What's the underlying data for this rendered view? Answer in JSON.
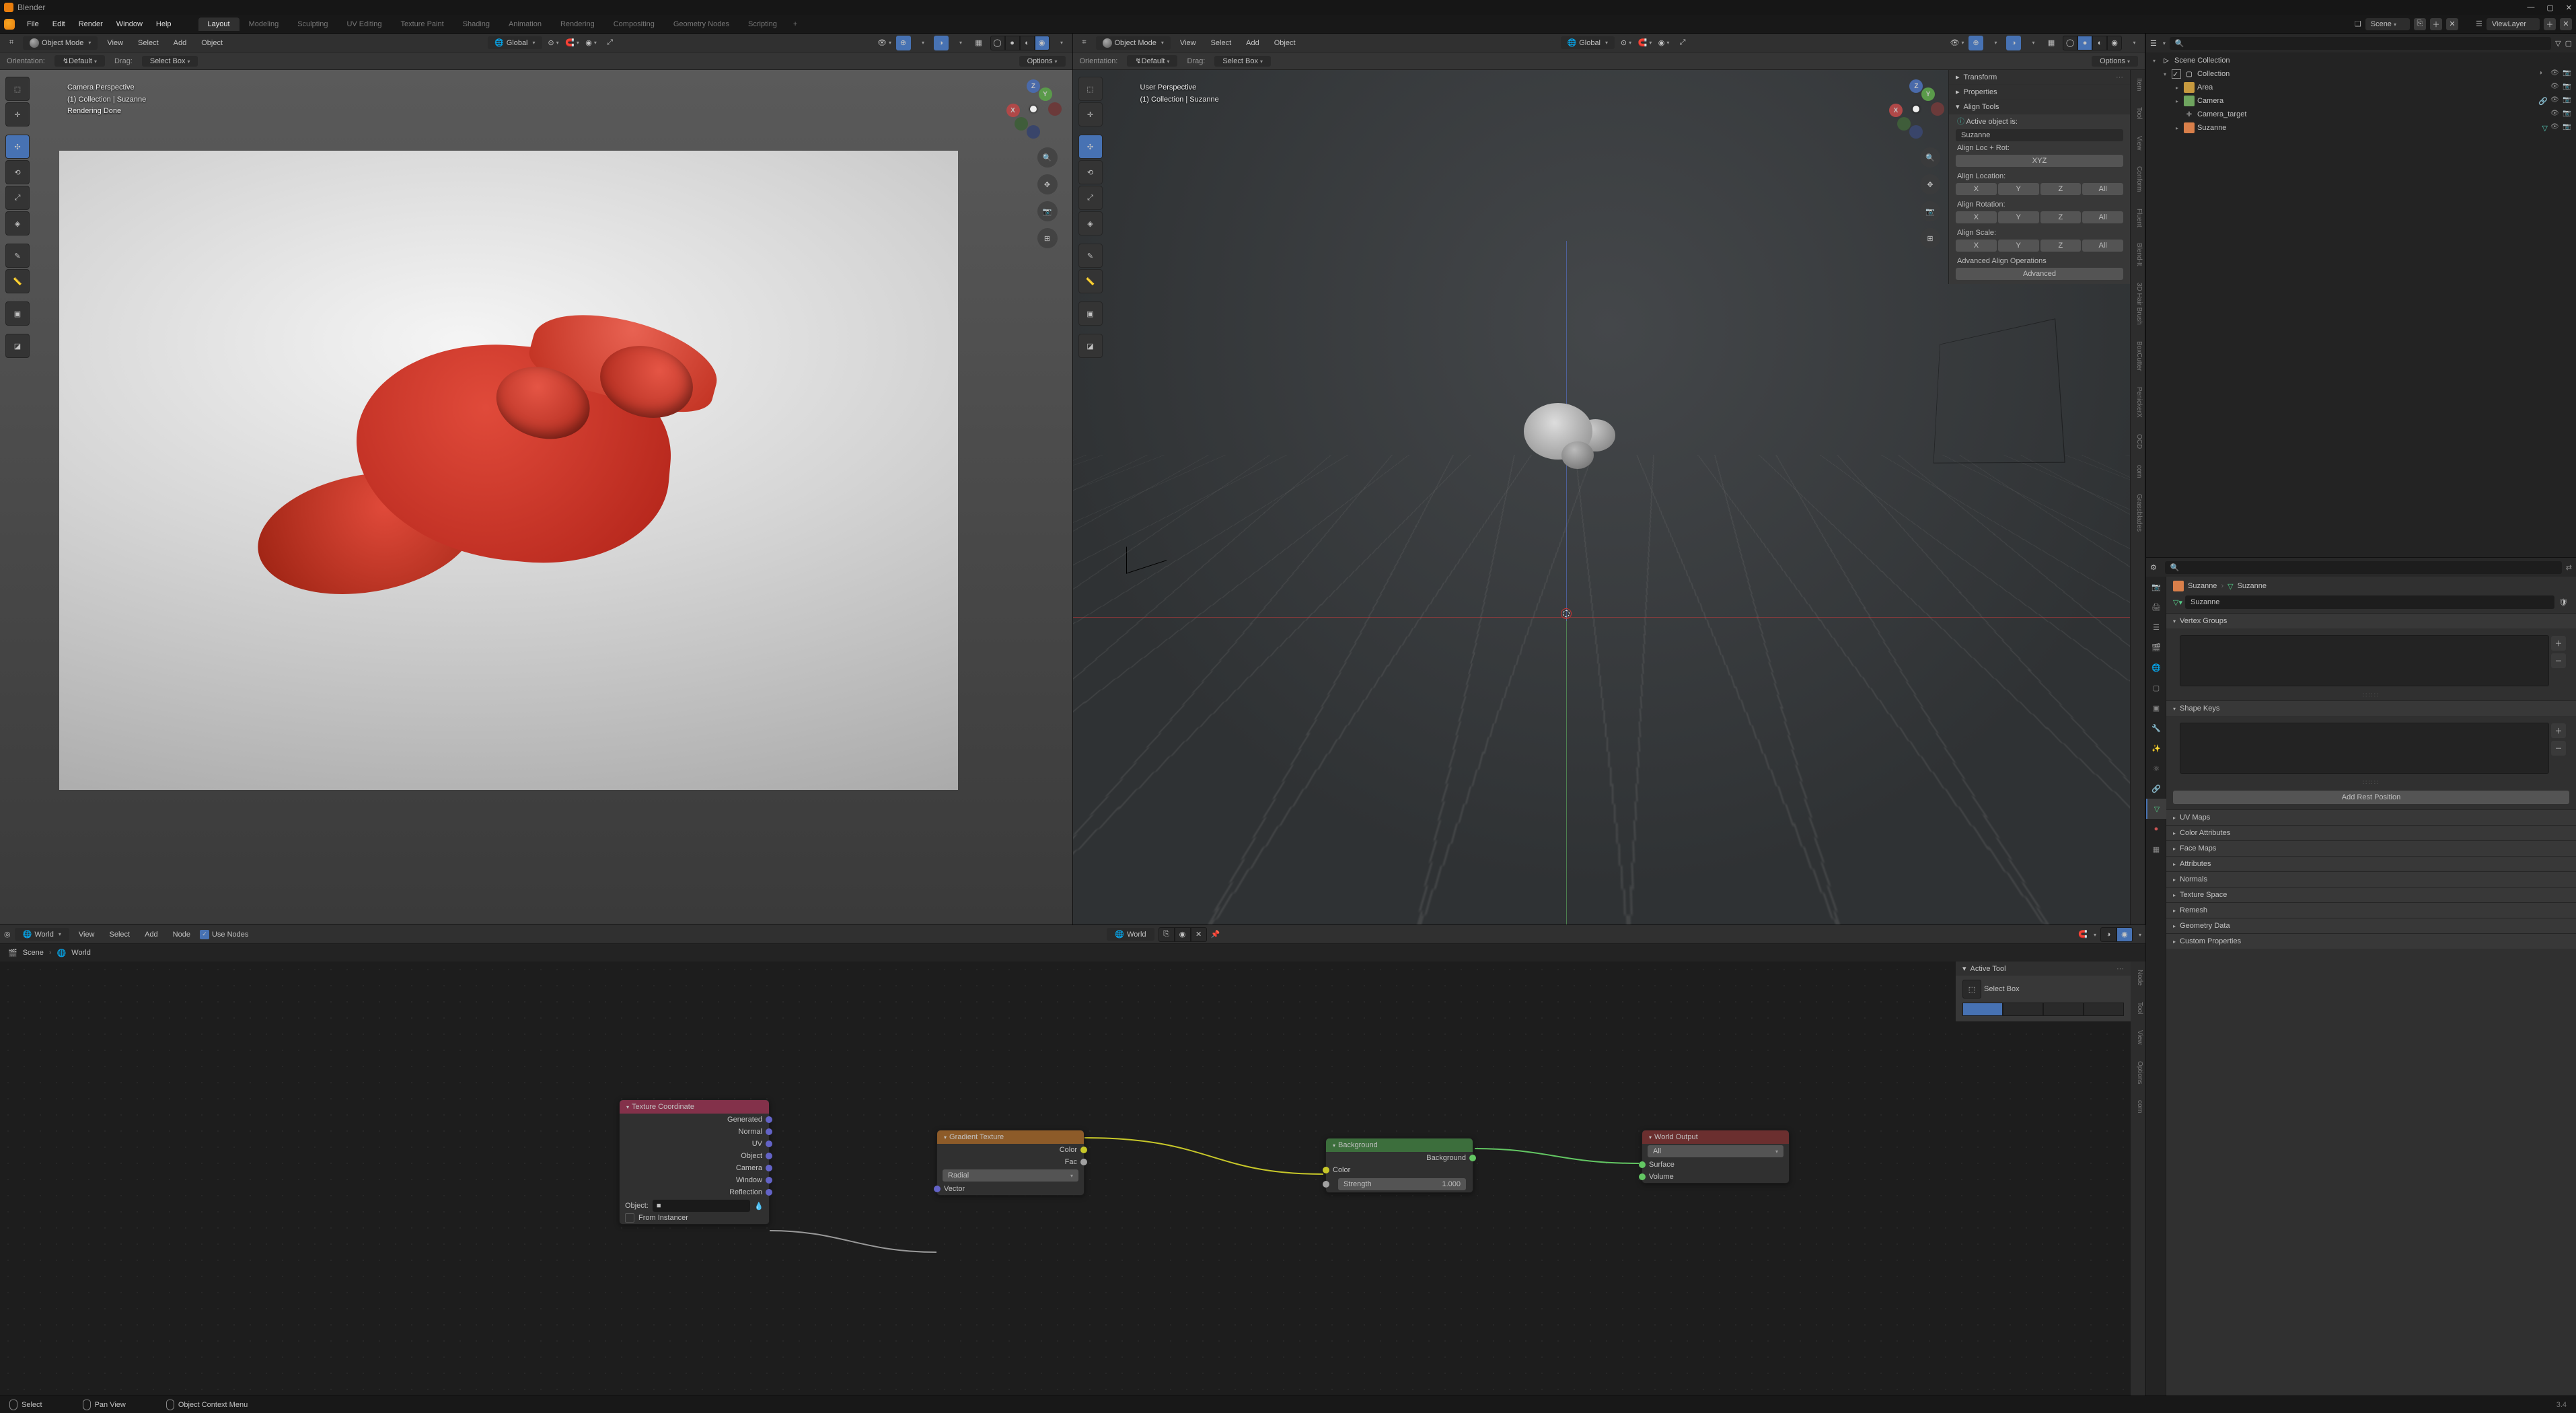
{
  "app": {
    "title": "Blender"
  },
  "topmenu": {
    "items": [
      "File",
      "Edit",
      "Render",
      "Window",
      "Help"
    ]
  },
  "workspaces": {
    "tabs": [
      "Layout",
      "Modeling",
      "Sculpting",
      "UV Editing",
      "Texture Paint",
      "Shading",
      "Animation",
      "Rendering",
      "Compositing",
      "Geometry Nodes",
      "Scripting"
    ],
    "active": "Layout"
  },
  "header_right": {
    "scene": "Scene",
    "viewlayer": "ViewLayer"
  },
  "viewport_header": {
    "mode": "Object Mode",
    "menus": [
      "View",
      "Select",
      "Add",
      "Object"
    ],
    "orientation": "Global"
  },
  "viewport_sub": {
    "orientation_lbl": "Orientation:",
    "orientation": "Default",
    "drag_lbl": "Drag:",
    "drag": "Select Box",
    "options": "Options"
  },
  "vp_left": {
    "perspective": "Camera Perspective",
    "collection": "(1) Collection | Suzanne",
    "status": "Rendering Done"
  },
  "vp_right": {
    "perspective": "User Perspective",
    "collection": "(1) Collection | Suzanne"
  },
  "navball": {
    "x": "X",
    "y": "Y",
    "z": "Z"
  },
  "npanel": {
    "transform": "Transform",
    "properties": "Properties",
    "align_tools": "Align Tools",
    "active_object": "Active object is:",
    "active_name": "Suzanne",
    "align_loc_rot": "Align Loc + Rot:",
    "xyz": "XYZ",
    "align_location": "Align Location:",
    "align_rotation": "Align Rotation:",
    "align_scale": "Align Scale:",
    "x": "X",
    "y": "Y",
    "z": "Z",
    "all": "All",
    "advanced": "Advanced Align Operations",
    "advanced_btn": "Advanced",
    "tabs": [
      "Item",
      "Tool",
      "View",
      "Conform",
      "Fluent",
      "Blend-It",
      "3D Hair Brush",
      "BoxCutter",
      "PenickerX",
      "OCD",
      "corn",
      "Grassblades"
    ]
  },
  "node_editor": {
    "type": "World",
    "menus": [
      "View",
      "Select",
      "Add",
      "Node"
    ],
    "use_nodes": "Use Nodes",
    "world_name": "World",
    "crumb_scene": "Scene",
    "crumb_world": "World"
  },
  "nodes": {
    "texcoord": {
      "title": "Texture Coordinate",
      "outs": [
        "Generated",
        "Normal",
        "UV",
        "Object",
        "Camera",
        "Window",
        "Reflection"
      ],
      "object_lbl": "Object:",
      "from_instancer": "From Instancer"
    },
    "gradient": {
      "title": "Gradient Texture",
      "color": "Color",
      "fac": "Fac",
      "type": "Radial",
      "vector": "Vector"
    },
    "background": {
      "title": "Background",
      "out": "Background",
      "color": "Color",
      "strength": "Strength",
      "strength_val": "1.000"
    },
    "world_output": {
      "title": "World Output",
      "target": "All",
      "surface": "Surface",
      "volume": "Volume"
    }
  },
  "ne_side": {
    "active_tool": "Active Tool",
    "select_box": "Select Box",
    "tabs": [
      "Node",
      "Tool",
      "View",
      "Options",
      "corn"
    ]
  },
  "outliner": {
    "root": "Scene Collection",
    "collection": "Collection",
    "items": [
      {
        "name": "Area",
        "type": "light"
      },
      {
        "name": "Camera",
        "type": "camera"
      },
      {
        "name": "Camera_target",
        "type": "empty"
      },
      {
        "name": "Suzanne",
        "type": "mesh"
      }
    ]
  },
  "properties": {
    "crumb1": "Suzanne",
    "crumb2": "Suzanne",
    "name": "Suzanne",
    "vertex_groups": "Vertex Groups",
    "shape_keys": "Shape Keys",
    "add_rest": "Add Rest Position",
    "sections": [
      "UV Maps",
      "Color Attributes",
      "Face Maps",
      "Attributes",
      "Normals",
      "Texture Space",
      "Remesh",
      "Geometry Data",
      "Custom Properties"
    ]
  },
  "footer": {
    "select": "Select",
    "pan": "Pan View",
    "context": "Object Context Menu",
    "version": "3.4"
  }
}
